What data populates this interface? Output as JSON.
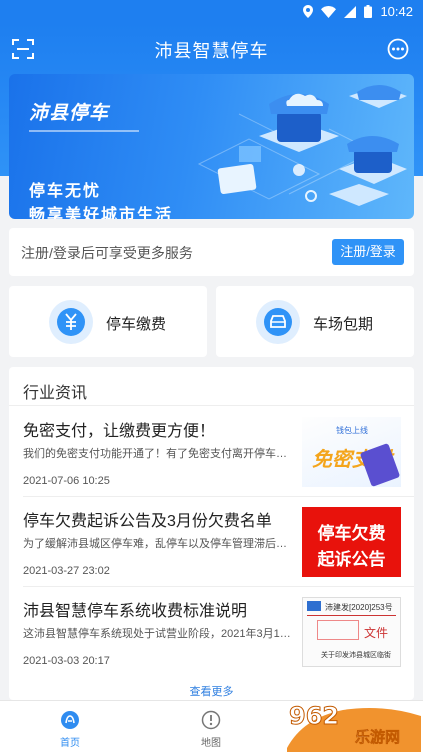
{
  "status_bar": {
    "time": "10:42"
  },
  "app_bar": {
    "title": "沛县智慧停车",
    "scan_icon": "scan-icon",
    "more_icon": "more-icon"
  },
  "banner": {
    "logo_text": "沛县停车",
    "line1": "停车无忧",
    "line2": "畅享美好城市生活"
  },
  "login": {
    "hint": "注册/登录后可享受更多服务",
    "button": "注册/登录"
  },
  "services": [
    {
      "label": "停车缴费",
      "icon": "payment-icon"
    },
    {
      "label": "车场包期",
      "icon": "car-icon"
    }
  ],
  "news": {
    "section_title": "行业资讯",
    "items": [
      {
        "title": "免密支付，让缴费更方便！",
        "desc": "我们的免密支付功能开通了！有了免密支付离开停车位时…",
        "date": "2021-07-06 10:25",
        "thumb": {
          "tag": "钱包上线",
          "text": "免密支付"
        }
      },
      {
        "title": "停车欠费起诉公告及3月份欠费名单",
        "desc": "为了缓解沛县城区停车难，乱停车以及停车管理滞后的问…",
        "date": "2021-03-27 23:02",
        "thumb": {
          "line1": "停车欠费",
          "line2": "起诉公告"
        }
      },
      {
        "title": "沛县智慧停车系统收费标准说明",
        "desc": "这沛县智慧停车系统现处于试营业阶段，2021年3月1日起…",
        "date": "2021-03-03 20:17",
        "thumb": {
          "header": "沛建发[2020]253号",
          "doc": "文件",
          "footer": "关于印发沛县城区临街"
        }
      }
    ],
    "more_link": "查看更多"
  },
  "tabbar": [
    {
      "label": "首页",
      "icon": "home-icon",
      "active": true
    },
    {
      "label": "地图",
      "icon": "map-icon",
      "active": false
    }
  ],
  "watermark": {
    "logo": "962",
    "text": "乐游网"
  },
  "colors": {
    "primary": "#2f93f7",
    "statusbar": "#1e7ff0",
    "accent_red": "#e8120c"
  }
}
